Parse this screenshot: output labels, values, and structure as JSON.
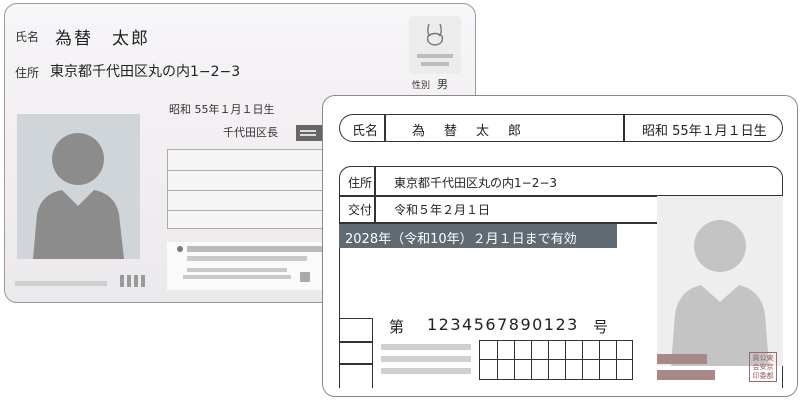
{
  "back_card": {
    "name_label": "氏名",
    "name_value": "為替　太郎",
    "address_label": "住所",
    "address_value": "東京都千代田区丸の内1−2−3",
    "gender_label": "性別",
    "gender_value": "男",
    "birth": "昭和 55年１月１日生",
    "authority": "千代田区長"
  },
  "license": {
    "name_label": "氏名",
    "name_value": "為　替　太　郎",
    "birth": "昭和 55年１月１日生",
    "address_label": "住所",
    "address_value": "東京都千代田区丸の内1−2−3",
    "issue_label": "交付",
    "issue_value": "令和５年２月１日",
    "valid_until": "2028年（令和10年）２月１日まで有効",
    "number_prefix": "第",
    "number_value": "1234567890123",
    "number_suffix": "号",
    "seal_text": [
      "員公東",
      "会安京",
      "印委都"
    ]
  },
  "colors": {
    "placeholder_gray": "#9b9b9b",
    "valid_bar": "#5f6a72",
    "seal_brown": "#a88888"
  }
}
